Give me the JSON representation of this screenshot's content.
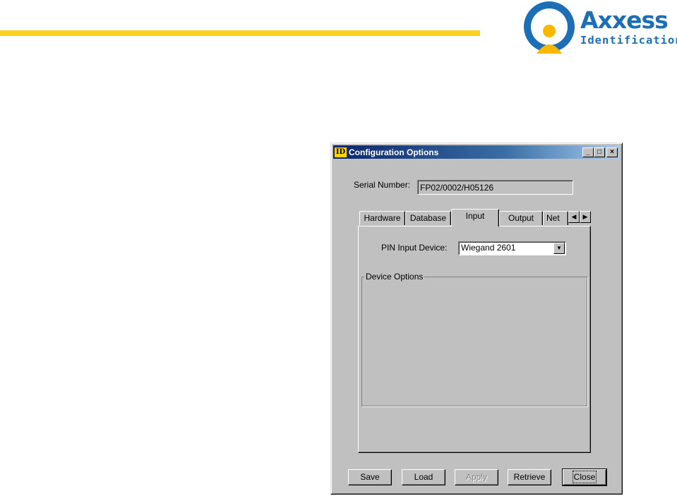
{
  "brand": {
    "name": "Axxess",
    "tagline": "Identification",
    "bar_color": "#f9d21c",
    "accent_color": "#1d6fb5"
  },
  "window": {
    "title": "Configuration Options",
    "icon_text": "ID",
    "controls": {
      "minimize": "_",
      "maximize": "□",
      "close": "×"
    },
    "serial_label": "Serial Number:",
    "serial_value": "FP02/0002/H05126",
    "tabs": [
      {
        "label": "Hardware",
        "active": false
      },
      {
        "label": "Database",
        "active": false
      },
      {
        "label": "Input",
        "active": true
      },
      {
        "label": "Output",
        "active": false
      },
      {
        "label": "Net",
        "active": false
      }
    ],
    "tab_scroll": {
      "left": "◀",
      "right": "▶"
    },
    "pin_label": "PIN Input Device:",
    "pin_value": "Wiegand 2601",
    "pin_arrow": "▼",
    "device_options_label": "Device Options",
    "buttons": {
      "save": "Save",
      "load": "Load",
      "apply": "Apply",
      "retrieve": "Retrieve",
      "close": "Close"
    }
  }
}
